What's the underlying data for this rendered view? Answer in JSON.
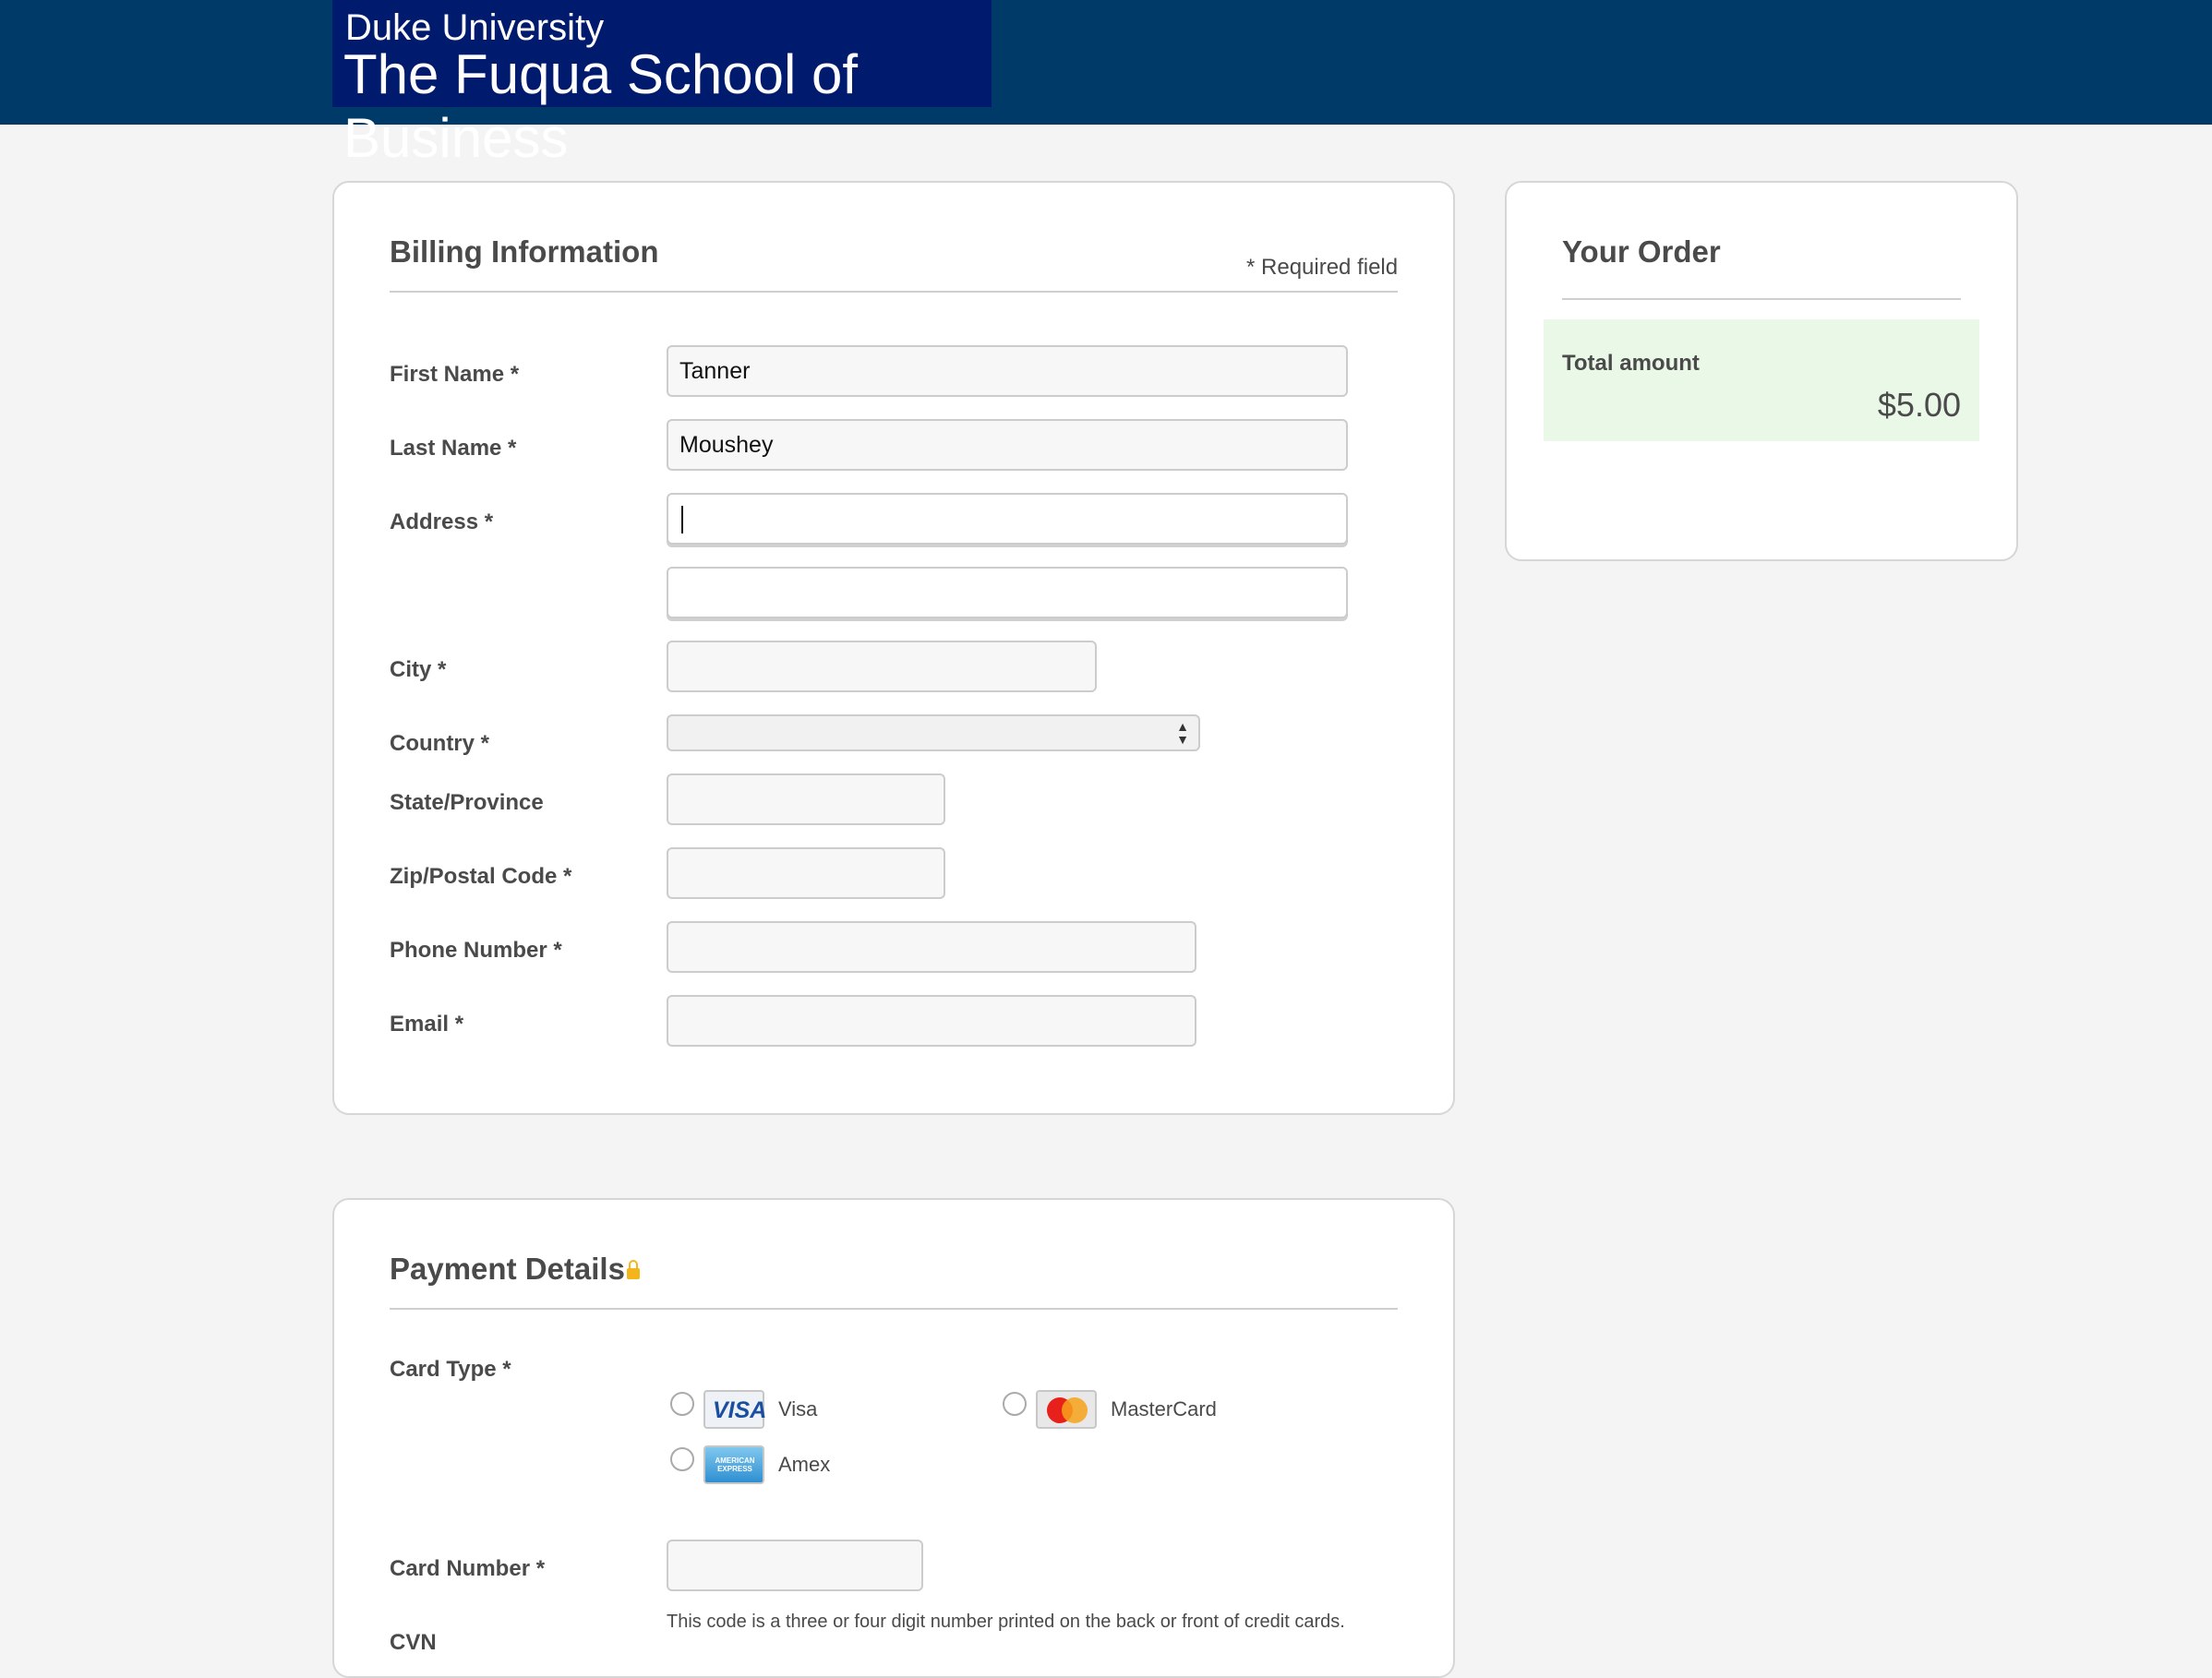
{
  "header": {
    "logo_line1": "Duke University",
    "logo_line2": "The Fuqua School of Business"
  },
  "billing": {
    "title": "Billing Information",
    "required_note": "* Required field",
    "fields": {
      "first_name": {
        "label": "First Name *",
        "value": "Tanner"
      },
      "last_name": {
        "label": "Last Name *",
        "value": "Moushey"
      },
      "address": {
        "label": "Address *",
        "value": ""
      },
      "address2": {
        "value": ""
      },
      "city": {
        "label": "City *",
        "value": ""
      },
      "country": {
        "label": "Country *",
        "value": ""
      },
      "state": {
        "label": "State/Province",
        "value": ""
      },
      "zip": {
        "label": "Zip/Postal Code *",
        "value": ""
      },
      "phone": {
        "label": "Phone Number *",
        "value": ""
      },
      "email": {
        "label": "Email *",
        "value": ""
      }
    }
  },
  "payment": {
    "title": "Payment Details",
    "card_type_label": "Card Type *",
    "card_types": [
      {
        "name": "Visa",
        "logo_text": "VISA"
      },
      {
        "name": "MasterCard",
        "logo_text": "MasterCard"
      },
      {
        "name": "Amex",
        "logo_text": "AMERICAN EXPRESS"
      }
    ],
    "card_number_label": "Card Number *",
    "cvn_help": "This code is a three or four digit number printed on the back or front of credit cards.",
    "cvn_label": "CVN"
  },
  "order": {
    "title": "Your Order",
    "total_label": "Total amount",
    "total_value": "$5.00"
  },
  "colors": {
    "header_bg": "#003a68",
    "logo_bg": "#001a6e",
    "total_bg": "#eaf8e8"
  }
}
